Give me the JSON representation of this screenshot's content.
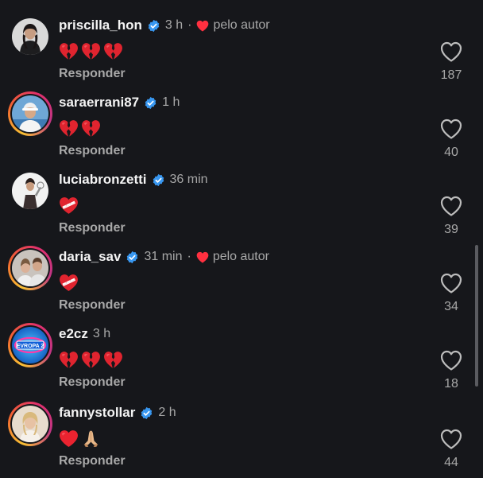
{
  "colors": {
    "background": "#16171b",
    "verified": "#3897f0",
    "liked_by_author_heart": "#ff3040",
    "secondary_text": "#a8a8a8"
  },
  "comments": [
    {
      "username": "priscilla_hon",
      "verified": true,
      "time": "3 h",
      "separator": "·",
      "liked_by_author": "pelo autor",
      "emojis": [
        "broken-heart",
        "broken-heart",
        "broken-heart"
      ],
      "reply_label": "Responder",
      "like_count": "187",
      "story_ring": false
    },
    {
      "username": "saraerrani87",
      "verified": true,
      "time": "1 h",
      "emojis": [
        "broken-heart",
        "broken-heart"
      ],
      "reply_label": "Responder",
      "like_count": "40",
      "story_ring": true
    },
    {
      "username": "luciabronzetti",
      "verified": true,
      "time": "36 min",
      "emojis": [
        "mending-heart"
      ],
      "reply_label": "Responder",
      "like_count": "39",
      "story_ring": false
    },
    {
      "username": "daria_sav",
      "verified": true,
      "time": "31 min",
      "separator": "·",
      "liked_by_author": "pelo autor",
      "emojis": [
        "mending-heart"
      ],
      "reply_label": "Responder",
      "like_count": "34",
      "story_ring": true
    },
    {
      "username": "e2cz",
      "verified": false,
      "time": "3 h",
      "emojis": [
        "broken-heart",
        "broken-heart",
        "broken-heart"
      ],
      "reply_label": "Responder",
      "like_count": "18",
      "story_ring": true,
      "avatar_logo_text": "EVROPA 2"
    },
    {
      "username": "fannystollar",
      "verified": true,
      "time": "2 h",
      "emojis": [
        "red-heart",
        "folded-hands"
      ],
      "reply_label": "Responder",
      "like_count": "44",
      "story_ring": true
    }
  ]
}
